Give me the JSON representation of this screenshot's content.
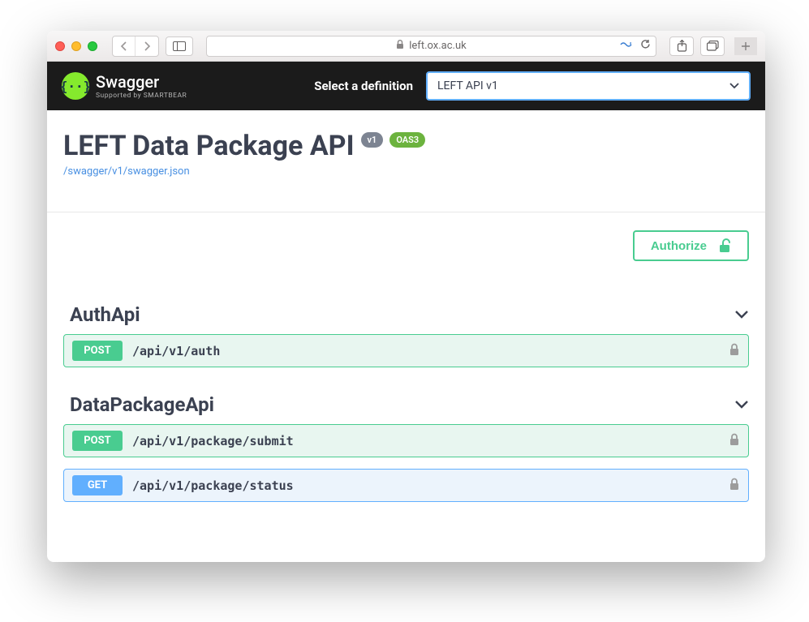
{
  "browser": {
    "url_host": "left.ox.ac.uk"
  },
  "topbar": {
    "brand": "Swagger",
    "brand_sub": "Supported by SMARTBEAR",
    "def_label": "Select a definition",
    "def_selected": "LEFT API v1"
  },
  "header": {
    "title": "LEFT Data Package API",
    "version_badge": "v1",
    "oas_badge": "OAS3",
    "spec_link": "/swagger/v1/swagger.json"
  },
  "authorize_label": "Authorize",
  "sections": [
    {
      "name": "AuthApi",
      "operations": [
        {
          "method": "POST",
          "path": "/api/v1/auth"
        }
      ]
    },
    {
      "name": "DataPackageApi",
      "operations": [
        {
          "method": "POST",
          "path": "/api/v1/package/submit"
        },
        {
          "method": "GET",
          "path": "/api/v1/package/status"
        }
      ]
    }
  ]
}
